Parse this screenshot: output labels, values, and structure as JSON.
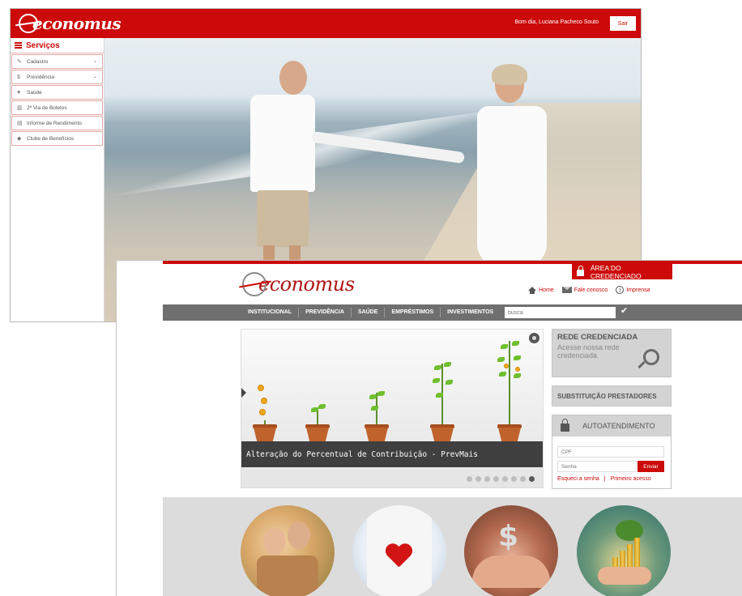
{
  "back_window": {
    "logo_text": "economus",
    "greeting": "Bom dia, Luciana Pacheco Souto",
    "logout_label": "Sair",
    "sidebar": {
      "title": "Serviços",
      "items": [
        {
          "label": "Cadastro",
          "icon": "edit-icon",
          "expandable": true
        },
        {
          "label": "Previdência",
          "icon": "dollar-icon",
          "expandable": true
        },
        {
          "label": "Saúde",
          "icon": "heart-icon",
          "expandable": false
        },
        {
          "label": "2ª Via de Boletos",
          "icon": "barcode-icon",
          "expandable": false
        },
        {
          "label": "Informe de Rendimento",
          "icon": "document-icon",
          "expandable": false
        },
        {
          "label": "Clube de Benefícios",
          "icon": "diamond-icon",
          "expandable": false
        }
      ]
    }
  },
  "front_window": {
    "credential_area": "ÁREA DO CREDENCIADO",
    "logo_text": "economus",
    "top_links": [
      {
        "label": "Home",
        "icon": "home-icon"
      },
      {
        "label": "Fale conosco",
        "icon": "mail-icon"
      },
      {
        "label": "Imprensa",
        "icon": "info-icon"
      }
    ],
    "nav": [
      "INSTITUCIONAL",
      "PREVIDÊNCIA",
      "SAÚDE",
      "EMPRÉSTIMOS",
      "INVESTIMENTOS"
    ],
    "search_placeholder": "busca",
    "slider": {
      "caption": "Alteração do Percentual de Contribuição - PrevMais",
      "dot_count": 8,
      "active_dot": 8
    },
    "rede": {
      "title": "REDE CREDENCIADA",
      "subtitle": "Acesse nossa rede credenciada"
    },
    "substituicao": "SUBSTITUIÇÃO PRESTADORES",
    "auto": {
      "title": "AUTOATENDIMENTO",
      "cpf_placeholder": "CPF",
      "senha_placeholder": "Senha",
      "send_label": "Enviar",
      "forgot_label": "Esqueci a senha",
      "separator": "|",
      "first_access_label": "Primeiro acesso"
    },
    "dollar_symbol": "$"
  },
  "colors": {
    "brand_red": "#cc0a0a",
    "nav_gray": "#6f6f6f",
    "panel_gray": "#d3d3d3"
  }
}
